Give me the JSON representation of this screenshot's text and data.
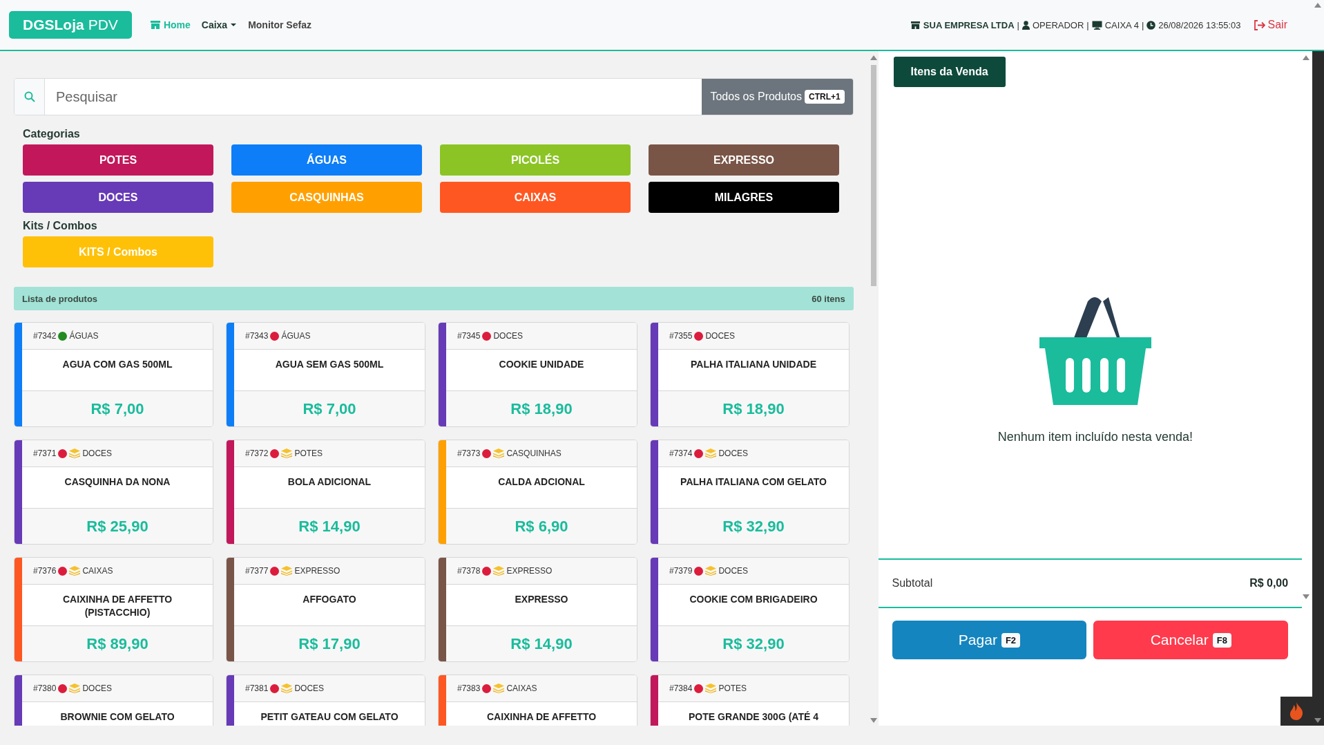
{
  "header": {
    "brand_bold": "DGSLoja",
    "brand_light": "PDV",
    "nav": [
      {
        "label": "Home",
        "selected": true,
        "kind": "icon"
      },
      {
        "label": "Caixa",
        "selected": false,
        "kind": "dropdown"
      },
      {
        "label": "Monitor Sefaz",
        "selected": false,
        "kind": "plain"
      }
    ],
    "company": "SUA EMPRESA LTDA",
    "operator": "OPERADOR",
    "register": "CAIXA 4",
    "datetime": "26/08/2026 13:55:03",
    "separator": "|",
    "logout": "Sair"
  },
  "search": {
    "placeholder": "Pesquisar",
    "all_products": "Todos os Produtos",
    "shortcut": "CTRL+1"
  },
  "categories_title": "Categorias",
  "categories": [
    {
      "label": "POTES",
      "color": "#c2185b"
    },
    {
      "label": "ÁGUAS",
      "color": "#0d7ef7"
    },
    {
      "label": "PICOLÉS",
      "color": "#8bc424"
    },
    {
      "label": "EXPRESSO",
      "color": "#795548"
    },
    {
      "label": "DOCES",
      "color": "#673ab7"
    },
    {
      "label": "CASQUINHAS",
      "color": "#ffa000"
    },
    {
      "label": "CAIXAS",
      "color": "#ff5722"
    },
    {
      "label": "MILAGRES",
      "color": "#000000"
    }
  ],
  "kits_title": "Kits / Combos",
  "kits": [
    {
      "label": "KITS / Combos",
      "color": "#ffc107"
    }
  ],
  "product_list": {
    "title": "Lista de produtos",
    "count": "60 itens"
  },
  "products": [
    {
      "code": "#7342",
      "status": {
        "color": "#228b22"
      },
      "stacked": false,
      "category": "ÁGUAS",
      "stripe": {
        "color": "#0d7ef7"
      },
      "name": "AGUA COM GAS 500ML",
      "price": "R$ 7,00"
    },
    {
      "code": "#7343",
      "status": {
        "color": "#dc1c3c"
      },
      "stacked": false,
      "category": "ÁGUAS",
      "stripe": {
        "color": "#0d7ef7"
      },
      "name": "AGUA SEM GAS 500ML",
      "price": "R$ 7,00"
    },
    {
      "code": "#7345",
      "status": {
        "color": "#dc1c3c"
      },
      "stacked": false,
      "category": "DOCES",
      "stripe": {
        "color": "#673ab7"
      },
      "name": "COOKIE UNIDADE",
      "price": "R$ 18,90"
    },
    {
      "code": "#7355",
      "status": {
        "color": "#dc1c3c"
      },
      "stacked": false,
      "category": "DOCES",
      "stripe": {
        "color": "#673ab7"
      },
      "name": "PALHA ITALIANA UNIDADE",
      "price": "R$ 18,90"
    },
    {
      "code": "#7371",
      "status": {
        "color": "#dc1c3c"
      },
      "stacked": true,
      "category": "DOCES",
      "stripe": {
        "color": "#673ab7"
      },
      "name": "CASQUINHA DA NONA",
      "price": "R$ 25,90"
    },
    {
      "code": "#7372",
      "status": {
        "color": "#dc1c3c"
      },
      "stacked": true,
      "category": "POTES",
      "stripe": {
        "color": "#c2185b"
      },
      "name": "BOLA ADICIONAL",
      "price": "R$ 14,90"
    },
    {
      "code": "#7373",
      "status": {
        "color": "#dc1c3c"
      },
      "stacked": true,
      "category": "CASQUINHAS",
      "stripe": {
        "color": "#ffa000"
      },
      "name": "CALDA ADCIONAL",
      "price": "R$ 6,90"
    },
    {
      "code": "#7374",
      "status": {
        "color": "#dc1c3c"
      },
      "stacked": true,
      "category": "DOCES",
      "stripe": {
        "color": "#673ab7"
      },
      "name": "PALHA ITALIANA COM GELATO",
      "price": "R$ 32,90"
    },
    {
      "code": "#7376",
      "status": {
        "color": "#dc1c3c"
      },
      "stacked": true,
      "category": "CAIXAS",
      "stripe": {
        "color": "#ff5722"
      },
      "name": "CAIXINHA DE AFFETTO (PISTACCHIO)",
      "price": "R$ 89,90"
    },
    {
      "code": "#7377",
      "status": {
        "color": "#dc1c3c"
      },
      "stacked": true,
      "category": "EXPRESSO",
      "stripe": {
        "color": "#795548"
      },
      "name": "AFFOGATO",
      "price": "R$ 17,90"
    },
    {
      "code": "#7378",
      "status": {
        "color": "#dc1c3c"
      },
      "stacked": true,
      "category": "EXPRESSO",
      "stripe": {
        "color": "#795548"
      },
      "name": "EXPRESSO",
      "price": "R$ 14,90"
    },
    {
      "code": "#7379",
      "status": {
        "color": "#dc1c3c"
      },
      "stacked": true,
      "category": "DOCES",
      "stripe": {
        "color": "#673ab7"
      },
      "name": "COOKIE COM BRIGADEIRO",
      "price": "R$ 32,90"
    },
    {
      "code": "#7380",
      "status": {
        "color": "#dc1c3c"
      },
      "stacked": true,
      "category": "DOCES",
      "stripe": {
        "color": "#673ab7"
      },
      "name": "BROWNIE COM GELATO"
    },
    {
      "code": "#7381",
      "status": {
        "color": "#dc1c3c"
      },
      "stacked": true,
      "category": "DOCES",
      "stripe": {
        "color": "#673ab7"
      },
      "name": "PETIT GATEAU COM GELATO"
    },
    {
      "code": "#7383",
      "status": {
        "color": "#dc1c3c"
      },
      "stacked": true,
      "category": "CAIXAS",
      "stripe": {
        "color": "#ff5722"
      },
      "name": "CAIXINHA DE AFFETTO"
    },
    {
      "code": "#7384",
      "status": {
        "color": "#dc1c3c"
      },
      "stacked": true,
      "category": "POTES",
      "stripe": {
        "color": "#c2185b"
      },
      "name": "POTE GRANDE 300G (ATÉ 4"
    }
  ],
  "sale": {
    "tab": "Itens da Venda",
    "empty": "Nenhum item incluído nesta venda!",
    "subtotal_label": "Subtotal",
    "subtotal": "R$ 0,00",
    "actions": [
      {
        "label": "Pagar",
        "key": "F2",
        "kind": "pay"
      },
      {
        "label": "Cancelar",
        "key": "F8",
        "kind": "cancel"
      }
    ]
  }
}
